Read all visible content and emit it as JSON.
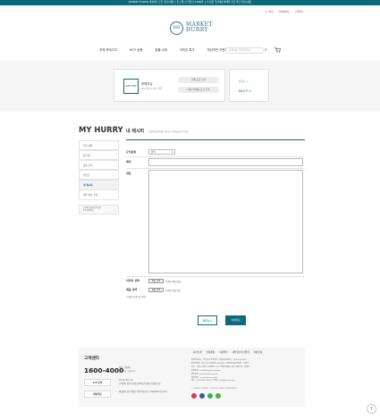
{
  "top_banner": "[MARKET HURRY] 마켓허리 오픈 기념 이벤트! 첫 구매 시 적립금 3,000원 + 전 상품 무료배송 혜택을 지금 바로 만나보세요",
  "top_links": [
    "로그아웃",
    "마이페이지",
    "고객센터"
  ],
  "logo": {
    "mark": "MH",
    "line1": "MARKET",
    "line2": "HURRY"
  },
  "gnb": [
    "전체 카테고리",
    "HOT 상품",
    "알뜰 쇼핑",
    "이번주 특가",
    "마감직전 이벤트"
  ],
  "search": {
    "placeholder": "검색어를 입력해주세요"
  },
  "user_box": {
    "grade_badge": "WELCOME",
    "name": "한해주님",
    "grade_text": "0% 할인 + 0% 적립",
    "btn_grade": "전체 등급 보기",
    "btn_benefit": "다음 달 예상 등급 보기"
  },
  "point_box": {
    "label": "적립금 >",
    "value": "600 P >"
  },
  "page_title": "MY HURRY",
  "side_menu": [
    {
      "label": "주문 내역",
      "active": false
    },
    {
      "label": "찜 목록",
      "active": false
    },
    {
      "label": "상품 후기",
      "active": false
    },
    {
      "label": "적립금",
      "active": false
    },
    {
      "label": "내 레시피",
      "active": true
    },
    {
      "label": "개인 정보 수정",
      "active": false
    }
  ],
  "side_ask": {
    "line1": "도움이 필요하신가요?",
    "line2": "1:1 문의하기"
  },
  "section": {
    "title": "내 레시피",
    "subtitle": "나만의 레시피를 공유하고 적립금을 받으세요"
  },
  "form": {
    "category_label": "요리분류",
    "category_value": "한식",
    "title_label": "제목",
    "content_label": "내용",
    "image_label": "이미지 선택",
    "image_btn": "파일 선택",
    "image_none": "선택된 파일 없음",
    "video_label": "제품 선택",
    "video_btn": "파일 선택",
    "video_none": "선택된 파일 없음",
    "note": "(구매한 상품 중 선택)",
    "cancel": "목록보기",
    "submit": "작성완료"
  },
  "footer": {
    "cs_title": "고객센터",
    "cs_phone": "1600-4000",
    "cs_hours_line1": "365 고객센터",
    "cs_hours_line2": "오전 7시 - 오후 7시",
    "row1_btn": "1:1 문의",
    "row1_line1": "24시간 접수 가능",
    "row1_line2": "고객센터 운영시간에 순차적으로 답변드리겠습니다.",
    "row2_btn": "대량주문",
    "row2_line1": "비회원의 경우 메일로 문의 바랍니다. (help@hurry.com)",
    "links": [
      "회사소개",
      "인재채용",
      "이용약관",
      "개인정보처리방침",
      "이용안내"
    ],
    "info": [
      "법인명(상호) : 주식회사 마켓허리 | 사업자등록번호 : 123-45-67890",
      "통신판매업 : 제 2023-서울강남-00000호 | 개인정보보호책임자 : 한해주",
      "주소 : 서울시 강남구 테헤란로 123, 마켓허리빌딩 5층 | 대표이사 : 한해주",
      "입점문의 : marketing@hurry.com",
      "제휴문의 : partner@hurry.com",
      "채용문의 : recruit@hurry.com",
      "팩스 : 070-0000-0000 | 이메일 : help@hurry.com"
    ],
    "copyright": "© MARKET HURRY CORP. ALL RIGHTS RESERVED",
    "social": [
      {
        "name": "instagram-icon",
        "color": "#d6395f"
      },
      {
        "name": "facebook-icon",
        "color": "#3b5998"
      },
      {
        "name": "kakaotalk-icon",
        "color": "#3bb54a"
      },
      {
        "name": "youtube-icon",
        "color": "#4caf50"
      }
    ]
  },
  "colors": {
    "brand": "#0d6a7c",
    "logo": "#2e6890"
  }
}
